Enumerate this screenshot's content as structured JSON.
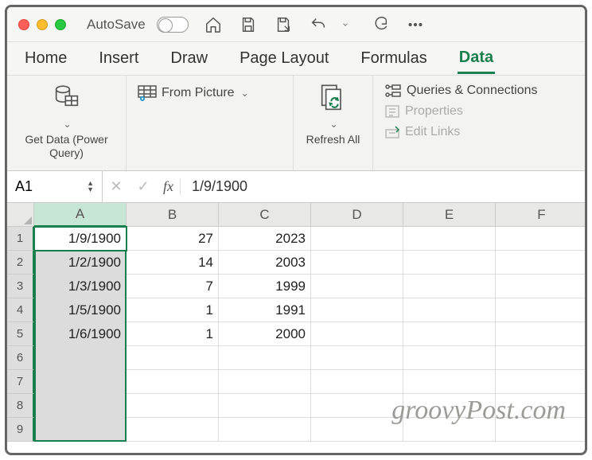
{
  "titlebar": {
    "autosave_label": "AutoSave"
  },
  "tabs": {
    "home": "Home",
    "insert": "Insert",
    "draw": "Draw",
    "page_layout": "Page Layout",
    "formulas": "Formulas",
    "data": "Data"
  },
  "ribbon": {
    "get_data": "Get Data (Power Query)",
    "from_picture": "From Picture",
    "refresh_all": "Refresh All",
    "queries": "Queries & Connections",
    "properties": "Properties",
    "edit_links": "Edit Links"
  },
  "namebox": {
    "ref": "A1"
  },
  "formula": {
    "value": "1/9/1900"
  },
  "columns": [
    "A",
    "B",
    "C",
    "D",
    "E",
    "F"
  ],
  "rows": [
    "1",
    "2",
    "3",
    "4",
    "5",
    "6",
    "7",
    "8",
    "9"
  ],
  "cells": {
    "r1": {
      "a": "1/9/1900",
      "b": "27",
      "c": "2023"
    },
    "r2": {
      "a": "1/2/1900",
      "b": "14",
      "c": "2003"
    },
    "r3": {
      "a": "1/3/1900",
      "b": "7",
      "c": "1999"
    },
    "r4": {
      "a": "1/5/1900",
      "b": "1",
      "c": "1991"
    },
    "r5": {
      "a": "1/6/1900",
      "b": "1",
      "c": "2000"
    }
  },
  "watermark": "groovyPost.com"
}
